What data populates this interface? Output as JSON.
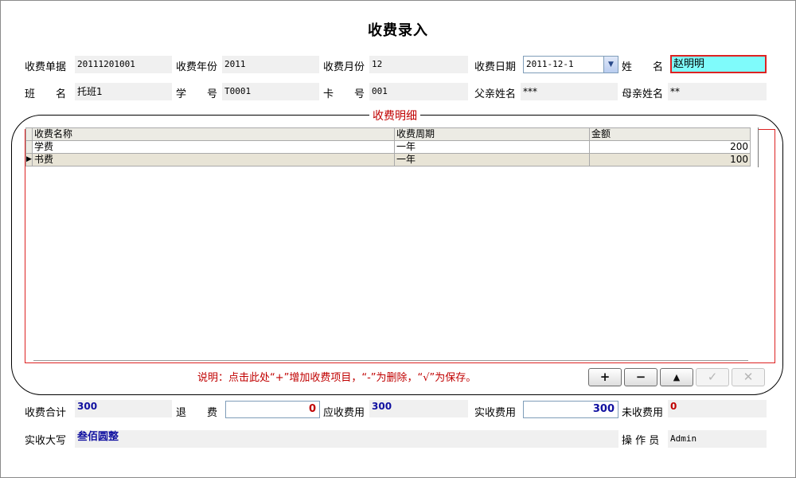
{
  "title": "收费录入",
  "row1": {
    "receipt_no_label": "收费单据",
    "receipt_no": "20111201001",
    "year_label": "收费年份",
    "year": "2011",
    "month_label": "收费月份",
    "month": "12",
    "date_label": "收费日期",
    "date": "2011-12-1",
    "name_label": "姓　　名",
    "name": "赵明明"
  },
  "row2": {
    "class_label": "班　　名",
    "class_name": "托班1",
    "student_no_label": "学　　号",
    "student_no": "T0001",
    "card_label": "卡　　号",
    "card_no": "001",
    "father_label": "父亲姓名",
    "father_name": "***",
    "mother_label": "母亲姓名",
    "mother_name": "**"
  },
  "details": {
    "group_title": "收费明细",
    "columns": [
      "收费名称",
      "收费周期",
      "金额"
    ],
    "rows": [
      {
        "name": "学费",
        "period": "一年",
        "amount": "200"
      },
      {
        "name": "书费",
        "period": "一年",
        "amount": "100"
      }
    ],
    "current_row_indicator": "▶",
    "note": "说明：点击此处“+”增加收费项目，“-”为删除，“√”为保存。",
    "buttons": {
      "add": "+",
      "delete": "−",
      "up": "▲",
      "save": "✓",
      "cancel": "✕"
    }
  },
  "totals": {
    "total_label": "收费合计",
    "total": "300",
    "refund_label": "退　　费",
    "refund": "0",
    "due_label": "应收费用",
    "due": "300",
    "paid_label": "实收费用",
    "paid": "300",
    "unpaid_label": "未收费用",
    "unpaid": "0"
  },
  "bottom": {
    "uppercase_label": "实收大写",
    "uppercase": "叁佰圆整",
    "operator_label": "操 作 员",
    "operator": "Admin"
  }
}
